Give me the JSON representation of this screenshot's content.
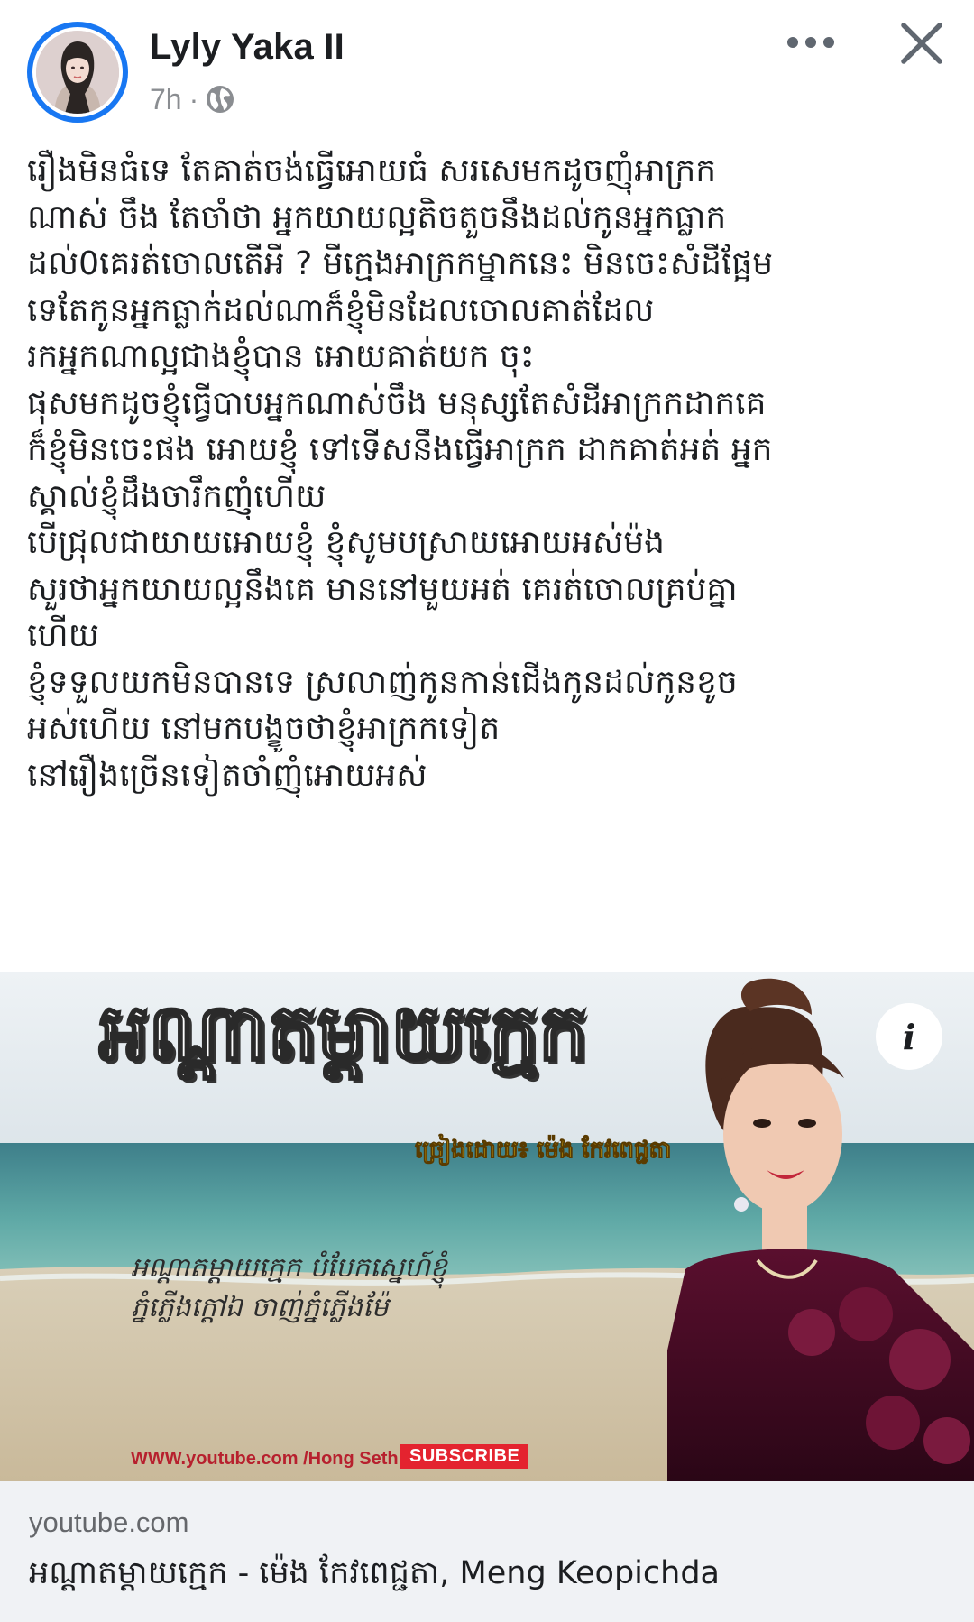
{
  "post": {
    "author": "Lyly Yaka II",
    "time": "7h",
    "meta_separator": "·",
    "audience_icon": "globe-icon",
    "actions": {
      "more_icon": "more-horizontal-icon",
      "close_icon": "close-icon"
    },
    "text_lines": [
      "រឿងមិនធំទេ តែគាត់ចង់ធ្វើអោយធំ សរសេមកដូចញុំអាក្រក",
      "ណាស់ ចឹង តែចាំថា អ្នកយាយល្អតិចតួចនឹងដល់កូនអ្នកធ្លាក",
      "ដល់0គេរត់ចោលតើអី ? មីក្មេងអាក្រកម្នាកនេះ មិនចេះសំដីផ្អែម",
      "ទេតែកូនអ្នកធ្លាក់ដល់ណាក៏ខ្ញុំមិនដែលចោលគាត់ដែល",
      "រកអ្នកណាល្អជាងខ្ញុំបាន អោយគាត់យក ចុះ",
      "ផុសមកដូចខ្ញុំធ្វើបាបអ្នកណាស់ចឹង មនុស្សតែសំដីអាក្រកដាកគេ",
      "ក៏ខ្ញុំមិនចេះផង អោយខ្ញុំ ទៅទើសនឹងធ្វើអាក្រក ដាកគាត់អត់ អ្នក",
      "ស្គាល់ខ្ញុំដឹងចារឹកញុំហើយ",
      "បើជ្រុលជាយាយអោយខ្ញុំ ខ្ញុំសូមបស្រាយអោយអស់ម៉ង",
      "សួរថាអ្នកយាយល្អនឹងគេ មាននៅមួយអត់ គេរត់ចោលគ្រប់គ្នា",
      "ហើយ",
      "ខ្ញុំទទួលយកមិនបានទេ ស្រលាញ់កូនកាន់ជើងកូនដល់កូនខូច",
      "អស់ហើយ នៅមកបង្ខូចថាខ្ញុំអាក្រកទៀត",
      "នៅរឿងច្រើនទៀតចាំញុំអោយអស់"
    ]
  },
  "link_preview": {
    "thumbnail": {
      "title": "អណ្ដាតម្ដាយក្មេក",
      "singer_label": "ច្រៀងដោយ៖ ម៉េង កែវពេជ្ជតា",
      "lyric_lines": [
        "អណ្ដាតម្ដាយក្មេក បំបែកស្នេហ៍ខ្ញុំ",
        "ភ្នំភ្លើងក្ដៅឯ ចាញ់ភ្នំភ្លើងម៉ែ"
      ],
      "channel_url": "WWW.youtube.com /Hong Seth",
      "subscribe_label": "SUBSCRIBE",
      "info_label": "i"
    },
    "domain": "youtube.com",
    "title": "អណ្ដាតម្ដាយក្មេក - ម៉េង កែវពេជ្ជតា, Meng Keopichda"
  },
  "colors": {
    "accent": "#1877f2",
    "secondary_text": "#65676b",
    "caption_bg": "#f0f2f5",
    "subscribe_red": "#e4232f"
  }
}
